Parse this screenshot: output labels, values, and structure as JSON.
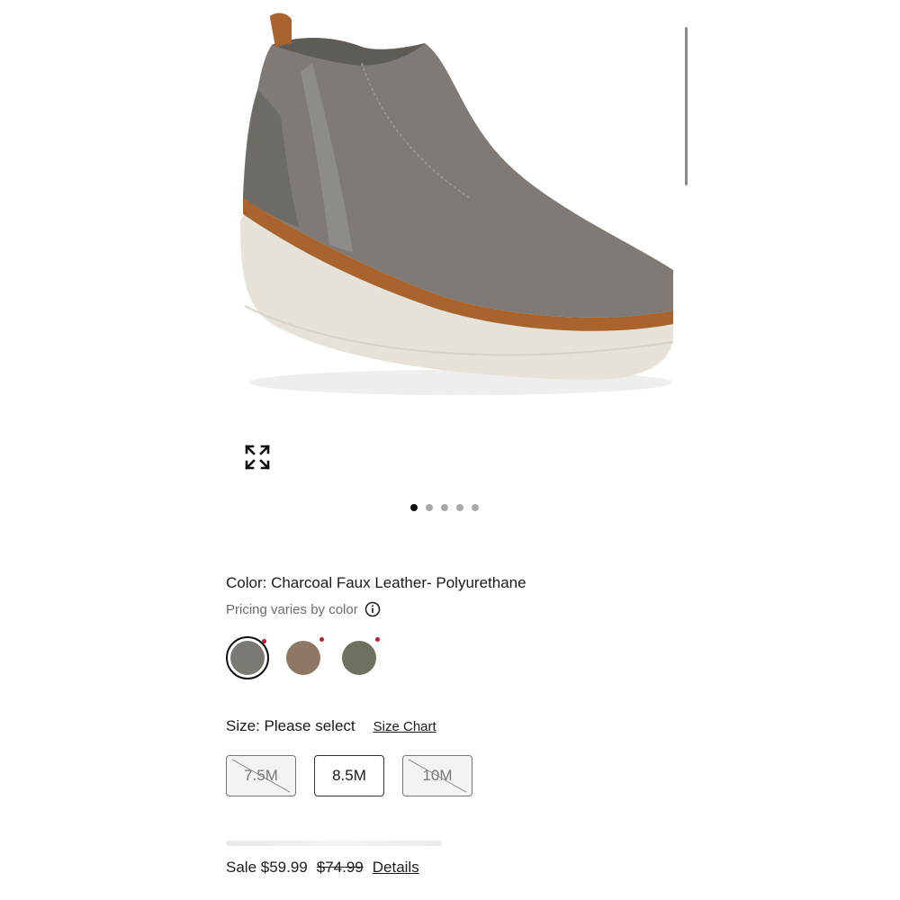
{
  "product": {
    "image_icon": "ankle-bootie-image",
    "expand_icon": "expand-icon"
  },
  "carousel": {
    "dots": 5,
    "active_index": 0
  },
  "color": {
    "label": "Color: Charcoal Faux Leather- Polyurethane",
    "pricing_note": "Pricing varies by color",
    "swatches": [
      {
        "color": "#7c7874",
        "selected": true
      },
      {
        "color": "#8e7865",
        "selected": false
      },
      {
        "color": "#6e715f",
        "selected": false
      }
    ]
  },
  "size": {
    "label": "Size: Please select",
    "chart_link": "Size Chart",
    "options": [
      {
        "label": "7.5M",
        "available": false
      },
      {
        "label": "8.5M",
        "available": true
      },
      {
        "label": "10M",
        "available": false
      }
    ]
  },
  "price": {
    "sale_label": "Sale $59.99",
    "original": "$74.99",
    "details_link": "Details"
  },
  "colors": {
    "accent_red": "#c0212b",
    "text": "#1a1a1a",
    "muted": "#6b6b6b"
  }
}
